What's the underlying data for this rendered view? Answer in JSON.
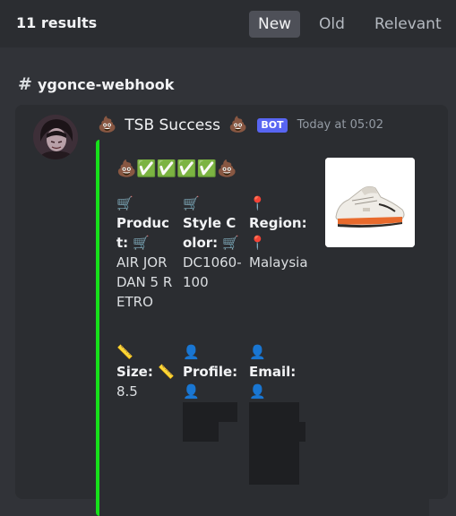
{
  "search": {
    "results_count": "11 results",
    "sort_tabs": [
      {
        "label": "New",
        "active": true
      },
      {
        "label": "Old",
        "active": false
      },
      {
        "label": "Relevant",
        "active": false
      }
    ]
  },
  "channel": {
    "hash": "#",
    "name": "ygonce-webhook"
  },
  "message": {
    "author": "TSB Success",
    "author_emoji": "💩",
    "bot_badge": "BOT",
    "timestamp": "Today at 05:02",
    "embed": {
      "accent_color": "#16e01a",
      "title": "💩✅✅✅✅💩",
      "thumbnail": "sneaker-image",
      "fields": [
        {
          "icon": "🛒",
          "name": "Product: 🛒",
          "value": "AIR JORDAN 5 RETRO"
        },
        {
          "icon": "🛒",
          "name": "Style Color: 🛒",
          "value": "DC1060-100"
        },
        {
          "icon": "📍",
          "name": "Region: 📍",
          "value": "Malaysia"
        },
        {
          "icon": "📏",
          "name": "Size: 📏",
          "value": "8.5"
        },
        {
          "icon": "👤",
          "name": "Profile: 👤",
          "value": ""
        },
        {
          "icon": "👤",
          "name": "Email: 👤",
          "value": ""
        }
      ]
    }
  }
}
